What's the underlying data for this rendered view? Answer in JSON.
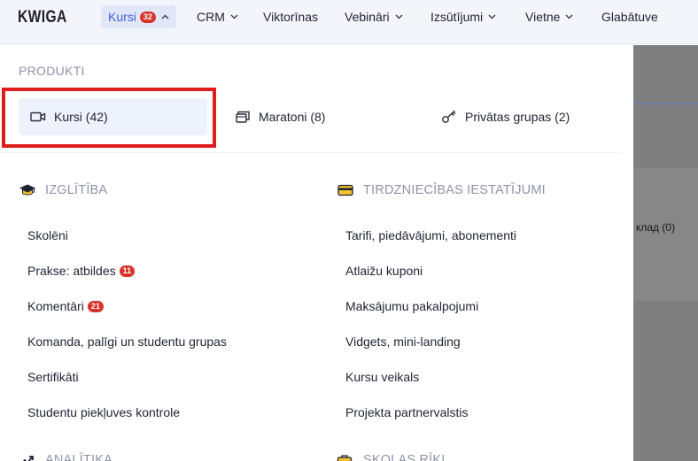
{
  "brand": {
    "logo": "KWIGA"
  },
  "nav": {
    "items": [
      {
        "label": "Kursi",
        "badge": "32",
        "active": true,
        "chevron": "up"
      },
      {
        "label": "CRM",
        "chevron": "down"
      },
      {
        "label": "Viktorīnas"
      },
      {
        "label": "Vebināri",
        "chevron": "down"
      },
      {
        "label": "Izsūtījumi",
        "chevron": "down"
      },
      {
        "label": "Vietne",
        "chevron": "down"
      },
      {
        "label": "Glabātuve"
      }
    ]
  },
  "dropdown": {
    "products_heading": "PRODUKTI",
    "products": [
      {
        "label": "Kursi (42)",
        "icon": "video-camera-icon",
        "active": true
      },
      {
        "label": "Maratoni (8)",
        "icon": "stack-icon"
      },
      {
        "label": "Privātas grupas (2)",
        "icon": "key-icon"
      }
    ],
    "education": {
      "heading": "IZGLĪTĪBA",
      "icon": "graduation-cap-icon",
      "links": [
        {
          "label": "Skolēni"
        },
        {
          "label": "Prakse: atbildes",
          "badge": "11"
        },
        {
          "label": "Komentāri",
          "badge": "21"
        },
        {
          "label": "Komanda, palīgi un studentu grupas"
        },
        {
          "label": "Sertifikāti"
        },
        {
          "label": "Studentu piekļuves kontrole"
        }
      ]
    },
    "trade": {
      "heading": "TIRDZNIECĪBAS IESTATĪJUMI",
      "icon": "credit-card-icon",
      "links": [
        {
          "label": "Tarifi, piedāvājumi, abonementi"
        },
        {
          "label": "Atlaižu kuponi"
        },
        {
          "label": "Maksājumu pakalpojumi"
        },
        {
          "label": "Vidgets, mini-landing"
        },
        {
          "label": "Kursu veikals"
        },
        {
          "label": "Projekta partnervalstis"
        }
      ]
    },
    "analytics": {
      "heading": "ANALĪTIKA",
      "icon": "chart-trend-icon"
    },
    "school_tools": {
      "heading": "SKOLAS RĪKI",
      "icon": "toolbox-icon"
    }
  },
  "background_page": {
    "partial_text": "клад (0)"
  },
  "colors": {
    "accent": "#3e62d6",
    "badge": "#d9342b",
    "highlight": "#e01d1d",
    "cap": "#1d2130",
    "card": "#f2c230"
  }
}
